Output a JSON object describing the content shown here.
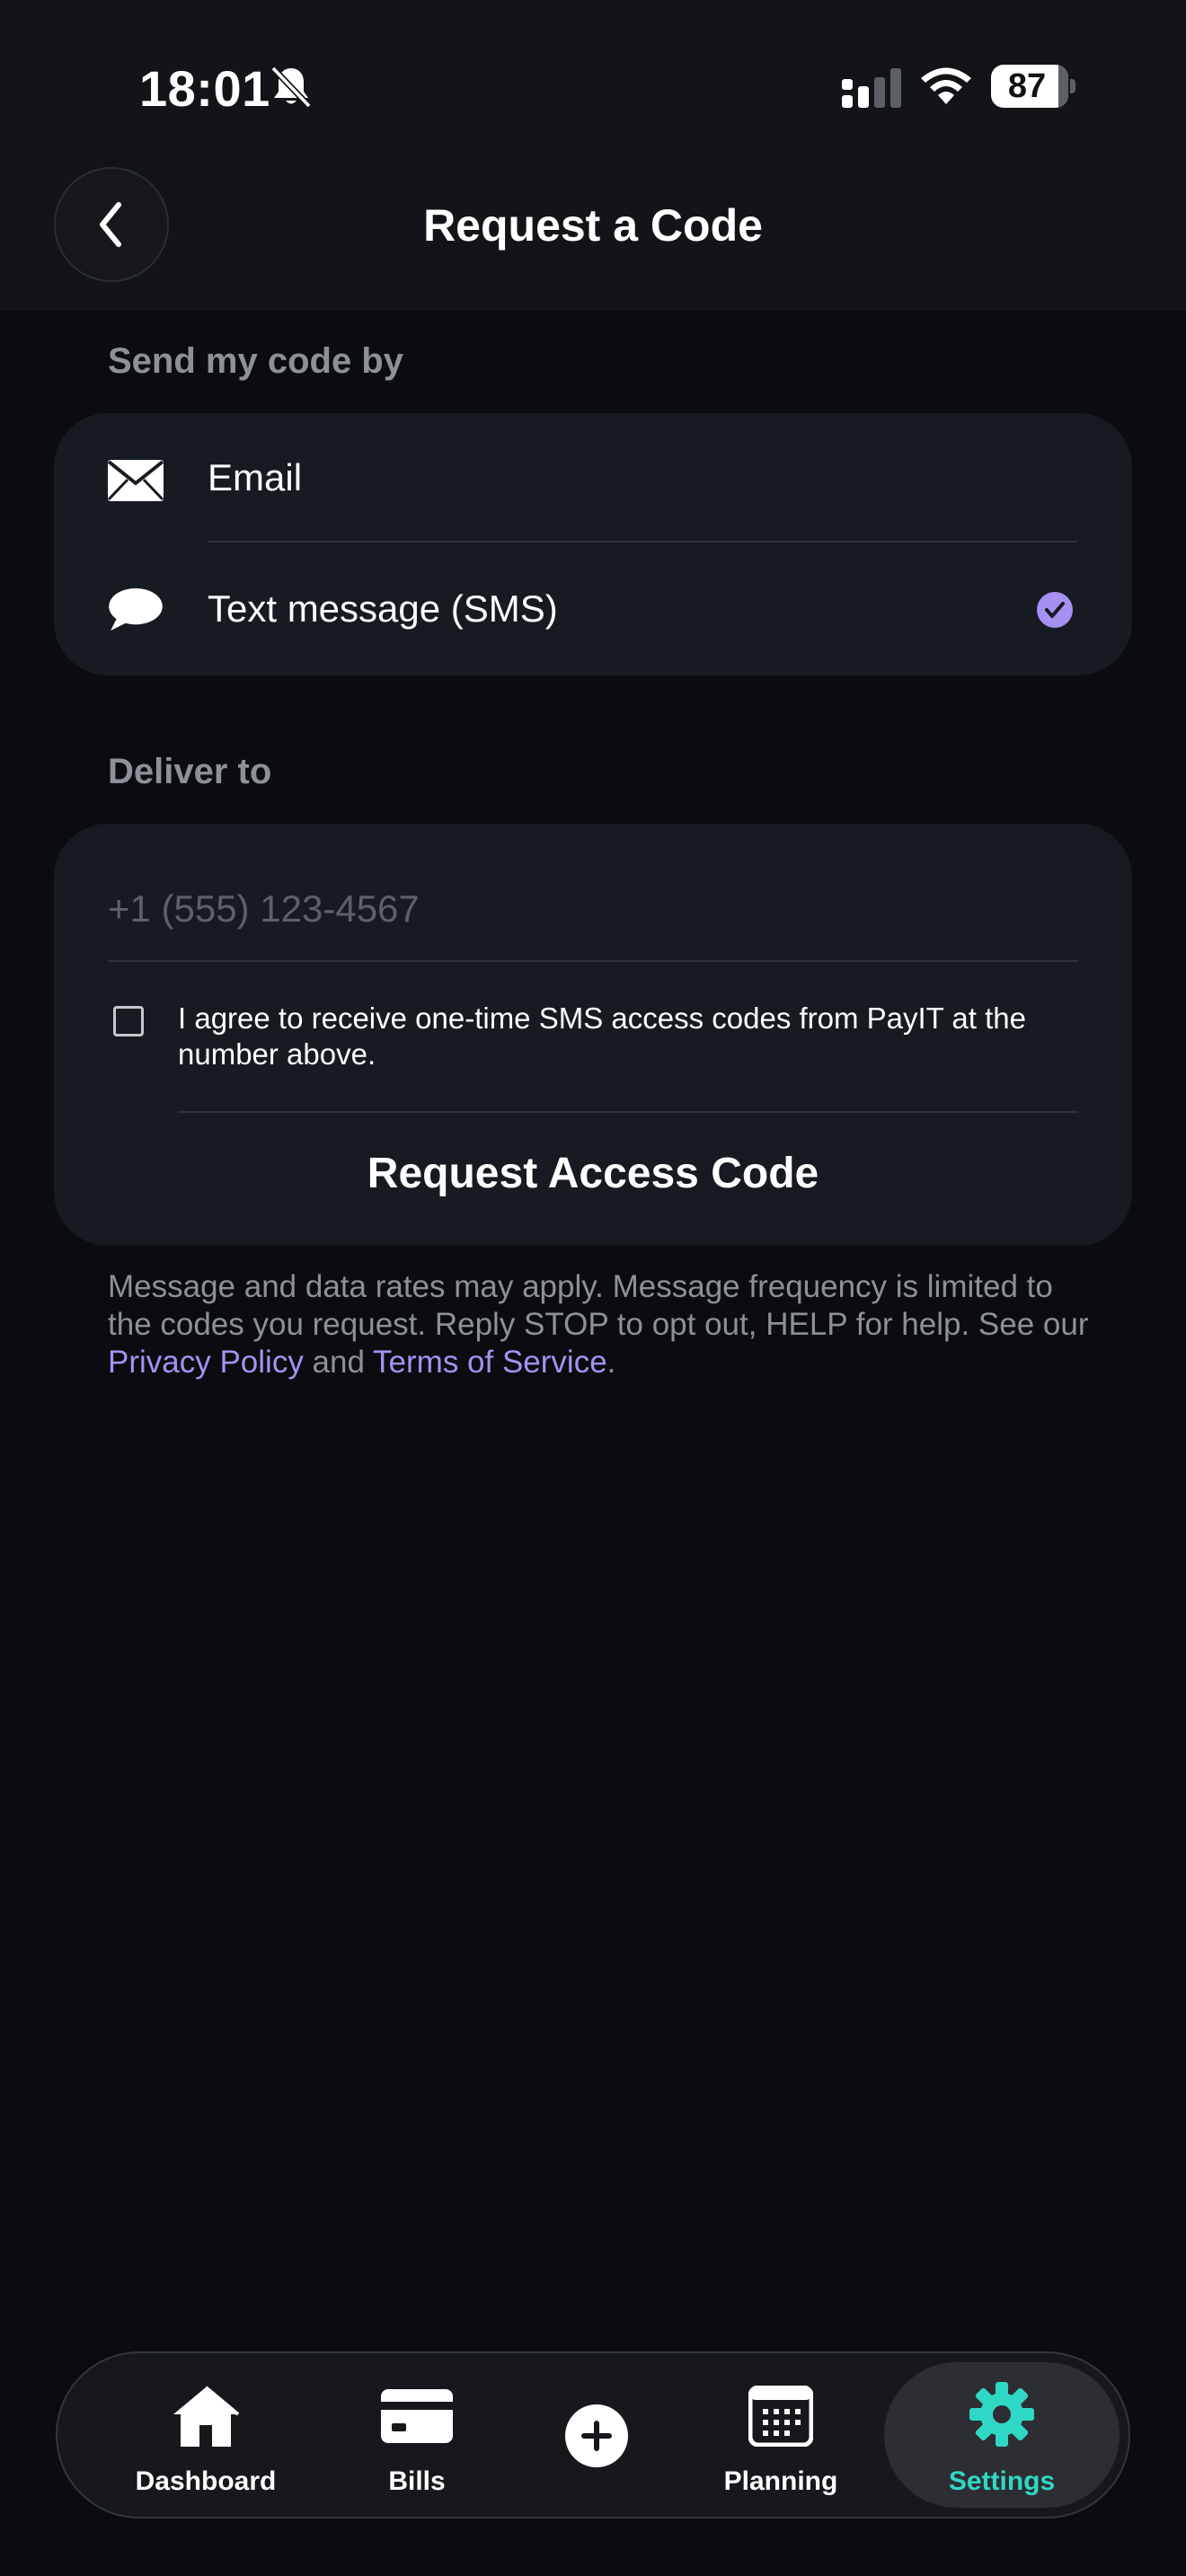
{
  "status_bar": {
    "time": "18:01",
    "battery_percent": "87",
    "battery_level": 0.87,
    "icons": [
      "bell-muted-icon",
      "cellular-signal-icon",
      "wifi-icon",
      "battery-icon"
    ]
  },
  "header": {
    "title": "Request a Code",
    "back_icon": "chevron-left-icon"
  },
  "send_by": {
    "label": "Send my code by",
    "options": [
      {
        "label": "Email",
        "icon": "envelope-icon",
        "selected": false
      },
      {
        "label": "Text message (SMS)",
        "icon": "chat-bubble-icon",
        "selected": true
      }
    ],
    "selected_icon": "checkmark-circle-icon"
  },
  "deliver_to": {
    "label": "Deliver to",
    "phone_value": "",
    "phone_placeholder": "+1 (555) 123-4567",
    "consent_checked": false,
    "consent_text": "I agree to receive one-time SMS access codes from PayIT at the number above.",
    "request_button": "Request Access Code"
  },
  "disclaimer": {
    "text_before": "Message and data rates may apply. Message frequency is limited to the codes you request. Reply STOP to opt out, HELP for help. See our ",
    "privacy_link": "Privacy Policy",
    "text_middle": " and ",
    "terms_link": "Terms of Service",
    "text_after": "."
  },
  "tab_bar": {
    "tabs": [
      {
        "label": "Dashboard",
        "icon": "house-icon",
        "active": false
      },
      {
        "label": "Bills",
        "icon": "credit-card-icon",
        "active": false
      },
      {
        "label": "",
        "icon": "plus-circle-icon",
        "active": false
      },
      {
        "label": "Planning",
        "icon": "calendar-icon",
        "active": false
      },
      {
        "label": "Settings",
        "icon": "gear-icon",
        "active": true
      }
    ]
  },
  "colors": {
    "accent_purple": "#a690f2",
    "accent_teal": "#2fd8c4",
    "card_bg": "#161a21",
    "page_bg": "#0b0c0f"
  }
}
